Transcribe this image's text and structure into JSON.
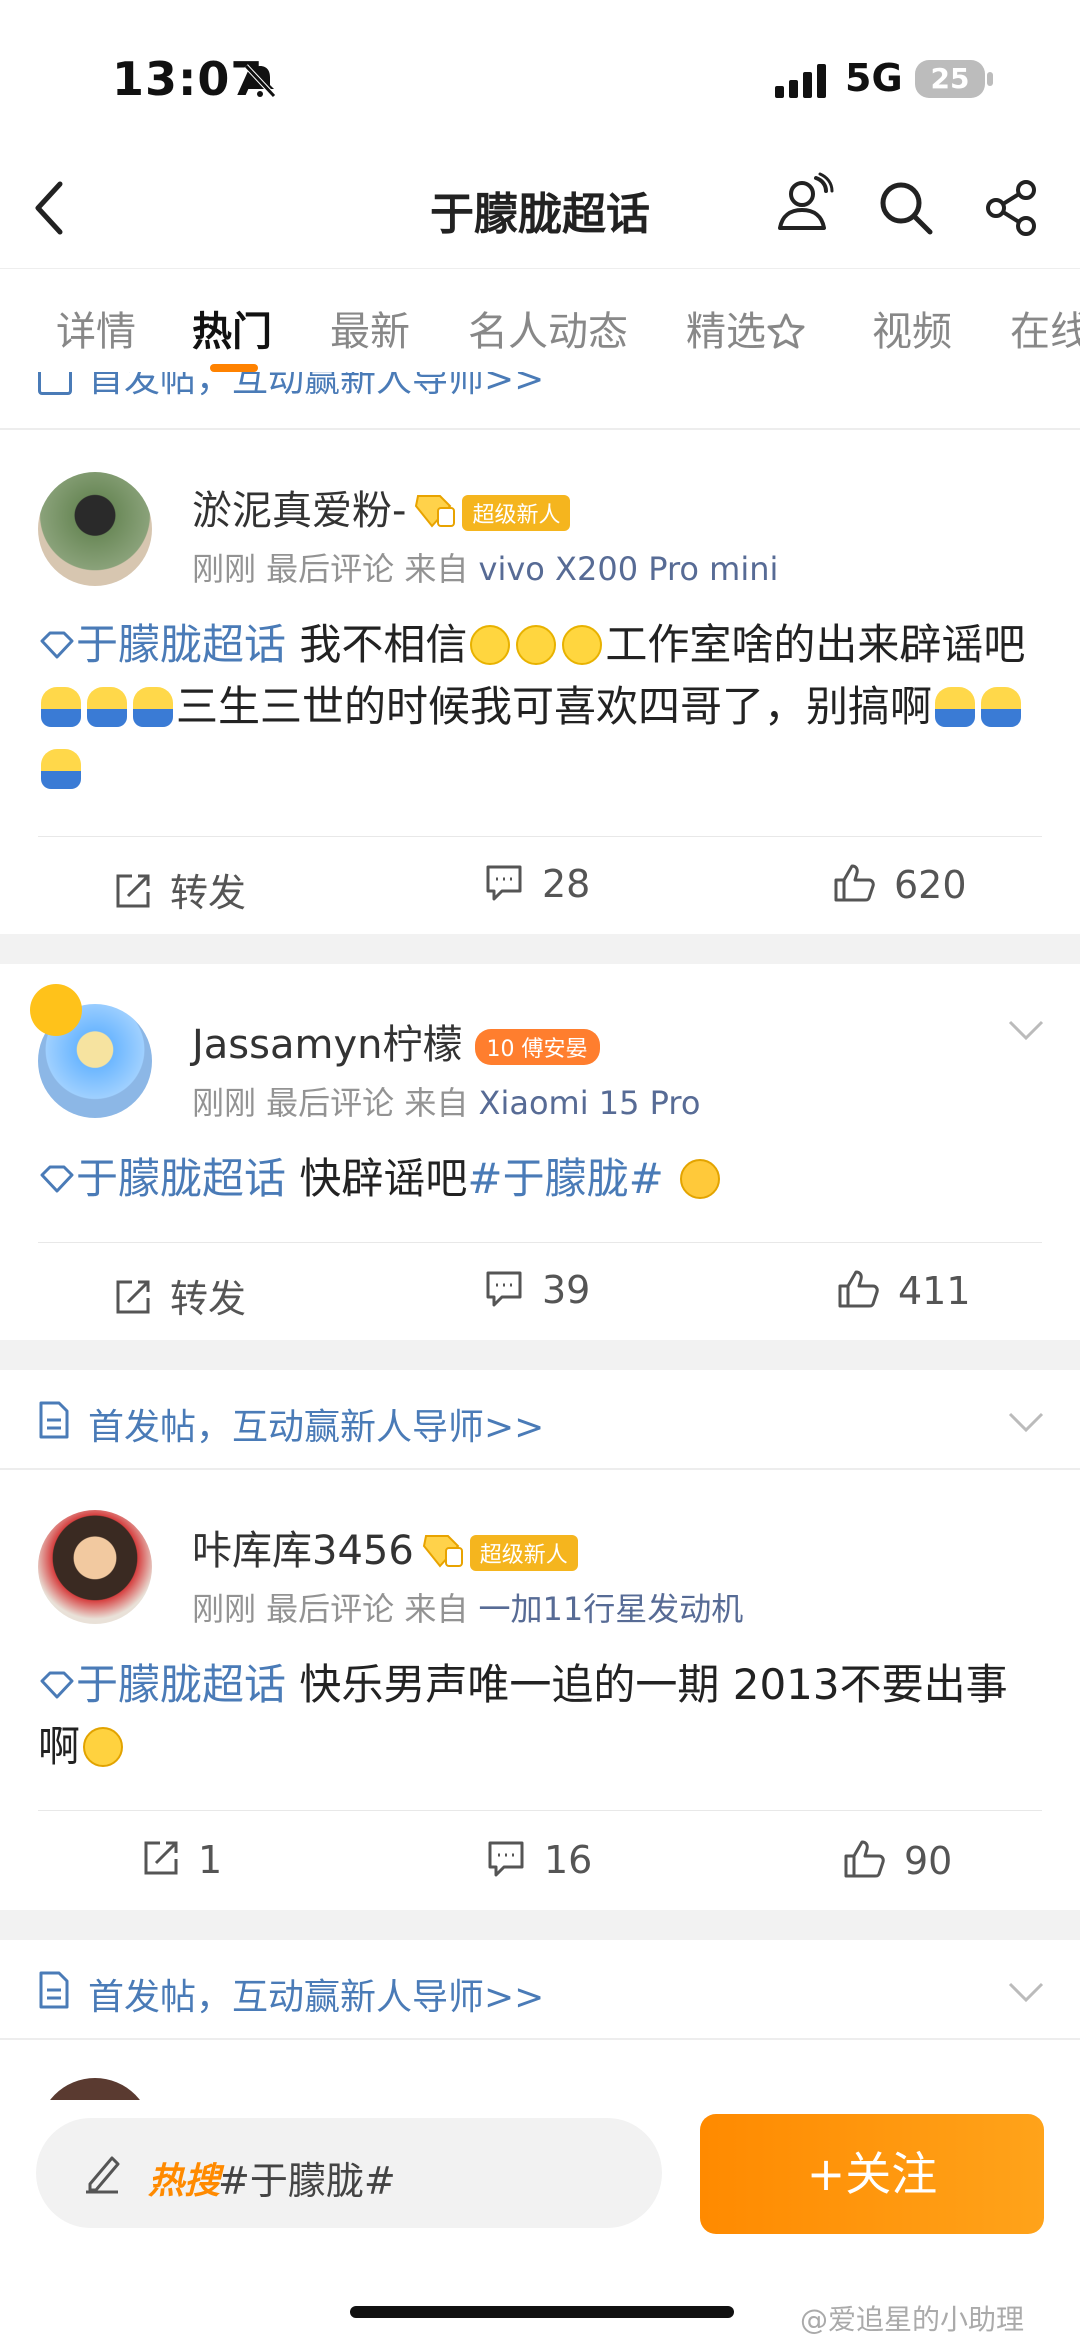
{
  "status": {
    "time": "13:07",
    "network": "5G",
    "battery": "25"
  },
  "nav": {
    "title": "于朦胧超话"
  },
  "tabs": [
    "详情",
    "热门",
    "最新",
    "名人动态",
    "精选",
    "视频",
    "在线"
  ],
  "notice_top": "首发帖，互动赢新人导师>>",
  "posts": [
    {
      "username": "淤泥真爱粉-",
      "badge": "超级新人",
      "meta_prefix": "刚刚  最后评论  来自",
      "source": "vivo X200 Pro mini",
      "topic": "于朦胧超话",
      "text1": "我不相信",
      "text2": "工作室啥的出来辟谣吧",
      "text3": "三生三世的时候我可喜欢四哥了，别搞啊",
      "repost": "转发",
      "comments": "28",
      "likes": "620"
    },
    {
      "username": "Jassamyn柠檬",
      "badge_level": "10",
      "badge": "傅安晏",
      "meta_prefix": "刚刚  最后评论  来自",
      "source": "Xiaomi 15 Pro",
      "topic": "于朦胧超话",
      "text1": "快辟谣吧",
      "hashtag": "#于朦胧#",
      "repost": "转发",
      "comments": "39",
      "likes": "411"
    },
    {
      "username": "咔库库3456",
      "badge": "超级新人",
      "meta_prefix": "刚刚  最后评论  来自",
      "source": "一加11行星发动机",
      "topic": "于朦胧超话",
      "text1": "快乐男声唯一追的一期 2013不要出事啊",
      "repost": "1",
      "comments": "16",
      "likes": "90"
    }
  ],
  "notice": "首发帖，互动赢新人导师>>",
  "bottom": {
    "hot_label": "热搜",
    "hot_topic": "#于朦胧#",
    "follow": "+关注"
  },
  "watermark": "@爱追星的小助理",
  "colors": {
    "accent": "#ff8200",
    "link": "#4a7bb7"
  }
}
